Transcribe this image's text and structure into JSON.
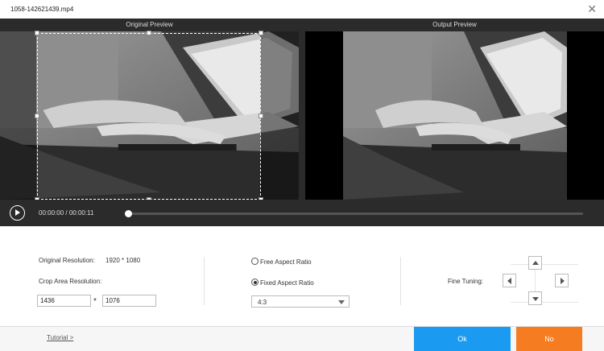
{
  "window": {
    "title": "1058-142621439.mp4",
    "close_glyph": "✕"
  },
  "preview": {
    "original_label": "Original Preview",
    "output_label": "Output Preview"
  },
  "player": {
    "current_time": "00:00:00",
    "separator": "/",
    "total_time": "00:00:11"
  },
  "settings": {
    "original_resolution_label": "Original Resolution:",
    "original_resolution_value": "1920 * 1080",
    "crop_area_label": "Crop Area Resolution:",
    "crop_width": "1436",
    "crop_height": "1076",
    "crop_separator": "*",
    "free_aspect_label": "Free Aspect Ratio",
    "fixed_aspect_label": "Fixed Aspect Ratio",
    "aspect_selected": "4:3",
    "fine_tuning_label": "Fine Tuning:"
  },
  "footer": {
    "tutorial_label": "Tutorial >",
    "ok_label": "Ok",
    "no_label": "No"
  },
  "colors": {
    "ok_blue": "#1a9af0",
    "no_orange": "#f57c20",
    "header_dark": "#2b2b2b"
  }
}
